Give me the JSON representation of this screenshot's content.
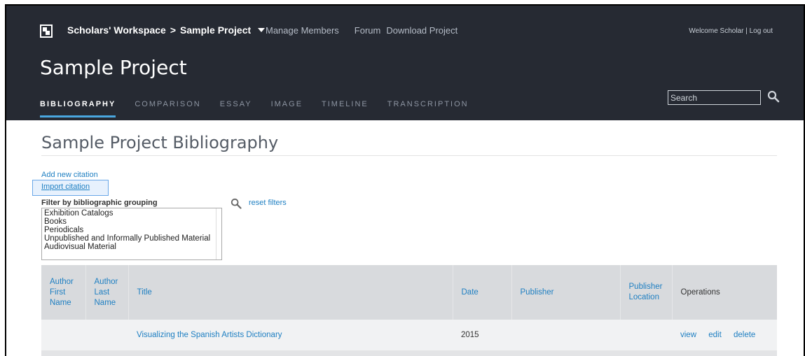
{
  "header": {
    "breadcrumb_site": "Scholars' Workspace",
    "breadcrumb_sep": ">",
    "breadcrumb_project": "Sample Project",
    "nav": [
      "Manage Members",
      "Forum",
      "Download Project"
    ],
    "user_welcome": "Welcome Scholar",
    "user_sep": "|",
    "logout": "Log out",
    "project_title": "Sample Project",
    "tabs": [
      "BIBLIOGRAPHY",
      "COMPARISON",
      "ESSAY",
      "IMAGE",
      "TIMELINE",
      "TRANSCRIPTION"
    ],
    "active_tab": "BIBLIOGRAPHY",
    "search_placeholder": "Search"
  },
  "main": {
    "page_title": "Sample Project Bibliography",
    "add_citation": "Add new citation",
    "import_citation": "Import citation",
    "filter_label": "Filter by bibliographic grouping",
    "filter_options": [
      "Exhibition Catalogs",
      "Books",
      "Periodicals",
      "Unpublished and Informally Published Material",
      "Audiovisual Material"
    ],
    "reset_filters": "reset filters"
  },
  "table": {
    "columns": {
      "first_name": "Author First Name",
      "last_name": "Author Last Name",
      "title": "Title",
      "date": "Date",
      "publisher": "Publisher",
      "publisher_location": "Publisher Location",
      "operations": "Operations"
    },
    "rows": [
      {
        "first_name": "",
        "last_name": "",
        "title": "Visualizing the Spanish Artists Dictionary",
        "date": "2015",
        "publisher": "",
        "publisher_location": "",
        "ops": [
          "view",
          "edit",
          "delete"
        ]
      }
    ]
  },
  "colors": {
    "header_bg": "#262a33",
    "accent": "#4aa7e0",
    "link": "#1e7fc2"
  }
}
